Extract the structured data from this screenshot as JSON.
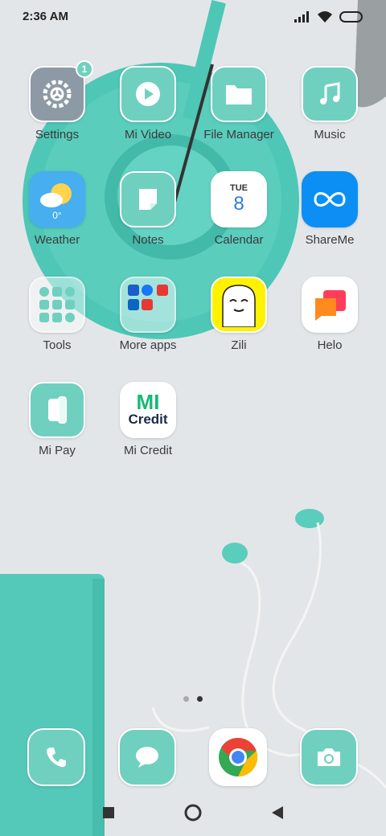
{
  "status_bar": {
    "time": "2:36 AM"
  },
  "apps_row1": [
    {
      "id": "settings",
      "label": "Settings",
      "badge": "1"
    },
    {
      "id": "mi-video",
      "label": "Mi Video"
    },
    {
      "id": "file-manager",
      "label": "File Manager"
    },
    {
      "id": "music",
      "label": "Music"
    }
  ],
  "apps_row2": [
    {
      "id": "weather",
      "label": "Weather",
      "temp": "0°"
    },
    {
      "id": "notes",
      "label": "Notes"
    },
    {
      "id": "calendar",
      "label": "Calendar",
      "day": "TUE",
      "date": "8"
    },
    {
      "id": "shareme",
      "label": "ShareMe"
    }
  ],
  "apps_row3": [
    {
      "id": "tools",
      "label": "Tools"
    },
    {
      "id": "more-apps",
      "label": "More apps"
    },
    {
      "id": "zili",
      "label": "Zili"
    },
    {
      "id": "helo",
      "label": "Helo"
    }
  ],
  "apps_row4": [
    {
      "id": "mi-pay",
      "label": "Mi Pay"
    },
    {
      "id": "mi-credit",
      "label": "Mi Credit",
      "logo_top": "MI",
      "logo_bottom": "Credit"
    }
  ],
  "page_indicator": {
    "total": 2,
    "active": 2
  },
  "dock": [
    "phone",
    "messages",
    "chrome",
    "camera"
  ],
  "colors": {
    "accent": "#6fd0c0",
    "background": "#e3e6e8"
  }
}
